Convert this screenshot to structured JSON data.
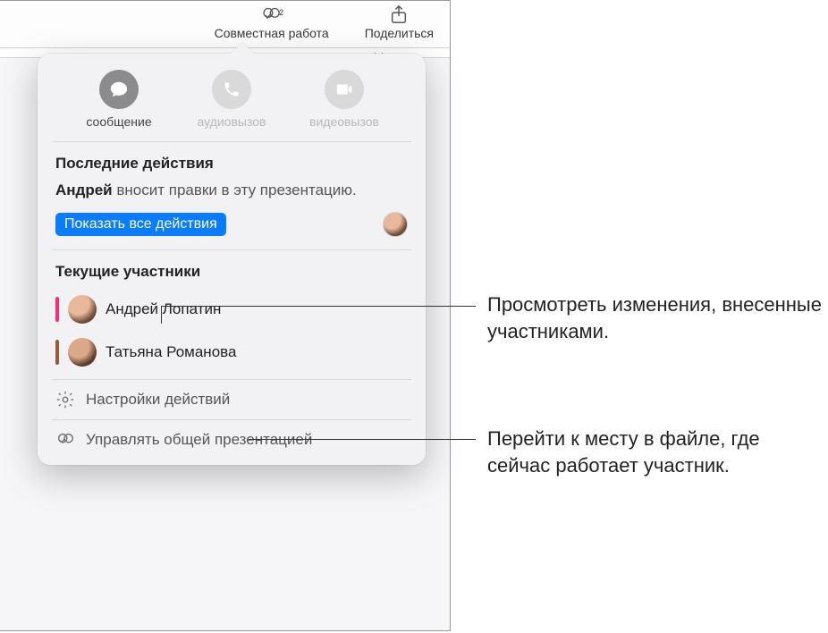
{
  "toolbar": {
    "collab_count": "2",
    "collab_label": "Совместная работа",
    "share_label": "Поделиться"
  },
  "contact": {
    "message": "сообщение",
    "audio": "аудиовызов",
    "video": "видеовызов"
  },
  "recent": {
    "title": "Последние действия",
    "actor": "Андрей",
    "rest": " вносит правки в эту презентацию.",
    "show_all": "Показать все действия"
  },
  "participants": {
    "title": "Текущие участники",
    "items": [
      {
        "name": "Андрей Лопатин"
      },
      {
        "name": "Татьяна Романова"
      }
    ]
  },
  "footer": {
    "settings": "Настройки действий",
    "manage": "Управлять общей презентацией"
  },
  "callouts": {
    "a": "Просмотреть изменения, внесенные участниками.",
    "b": "Перейти к месту в файле, где сейчас работает участник."
  }
}
